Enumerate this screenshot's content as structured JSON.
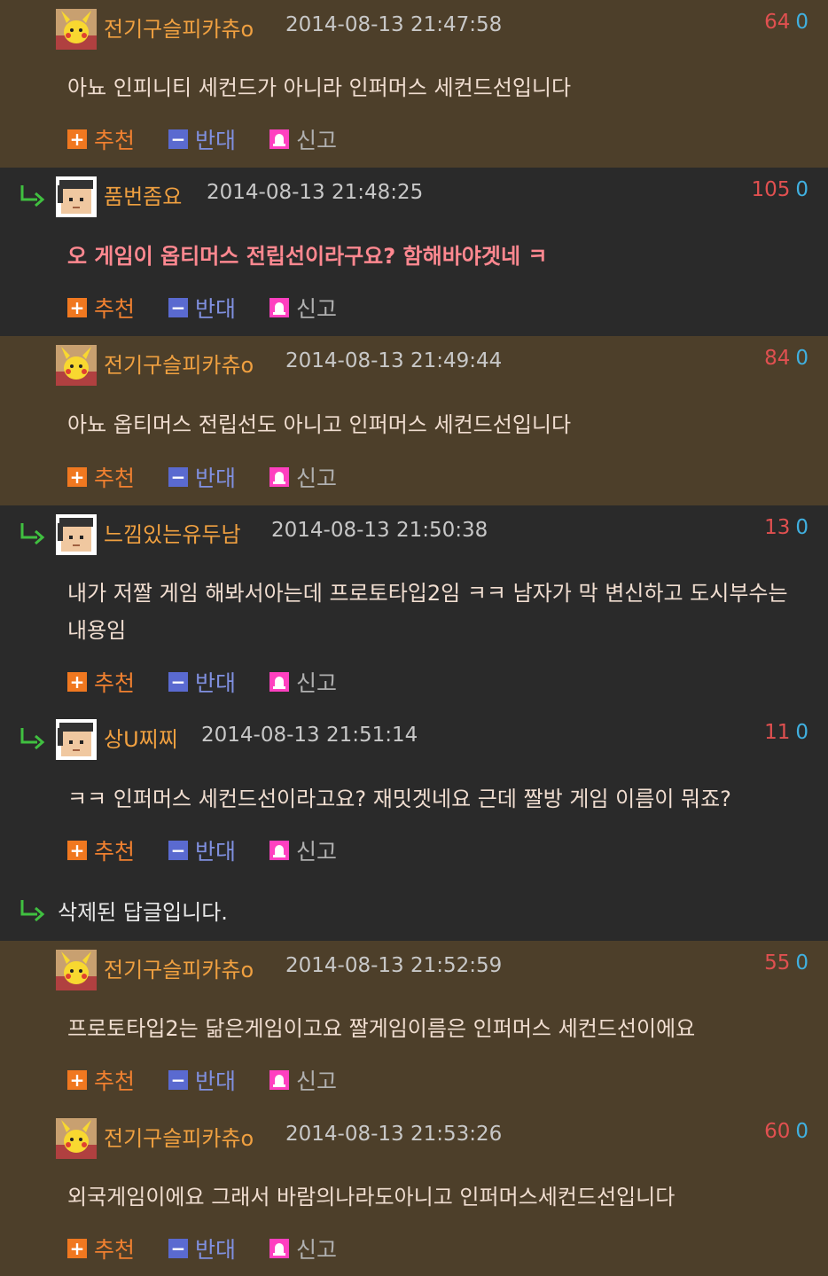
{
  "actions": {
    "up": "추천",
    "down": "반대",
    "report": "신고"
  },
  "comments": [
    {
      "nick": "전기구슬피카츄o",
      "date": "2014-08-13 21:47:58",
      "up": "64",
      "down": "0",
      "body": "아뇨 인피니티 세컨드가 아니라 인퍼머스 세컨드선입니다"
    },
    {
      "nick": "품번좀요",
      "date": "2014-08-13 21:48:25",
      "up": "105",
      "down": "0",
      "body": "오 게임이 옵티머스 전립선이라구요? 함해바야겟네 ㅋ"
    },
    {
      "nick": "전기구슬피카츄o",
      "date": "2014-08-13 21:49:44",
      "up": "84",
      "down": "0",
      "body": "아뇨 옵티머스 전립선도 아니고 인퍼머스 세컨드선입니다"
    },
    {
      "nick": "느낌있는유두남",
      "date": "2014-08-13 21:50:38",
      "up": "13",
      "down": "0",
      "body": "내가 저짤 게임 해봐서아는데 프로토타입2임 ㅋㅋ 남자가 막 변신하고 도시부수는내용임"
    },
    {
      "nick": "상U찌찌",
      "date": "2014-08-13 21:51:14",
      "up": "11",
      "down": "0",
      "body": "ㅋㅋ 인퍼머스 세컨드선이라고요? 재밋겟네요 근데 짤방 게임 이름이 뭐죠?"
    },
    {
      "deleted": "삭제된 답글입니다."
    },
    {
      "nick": "전기구슬피카츄o",
      "date": "2014-08-13 21:52:59",
      "up": "55",
      "down": "0",
      "body": "프로토타입2는 닮은게임이고요 짤게임이름은 인퍼머스 세컨드선이에요"
    },
    {
      "nick": "전기구슬피카츄o",
      "date": "2014-08-13 21:53:26",
      "up": "60",
      "down": "0",
      "body": "외국게임이에요 그래서 바람의나라도아니고 인퍼머스세컨드선입니다"
    }
  ]
}
